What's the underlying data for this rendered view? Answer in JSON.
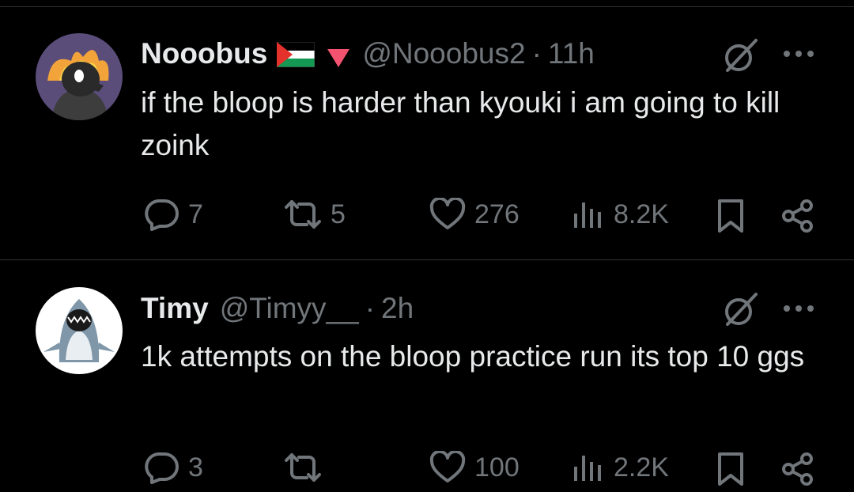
{
  "posts": [
    {
      "author": {
        "name": "Nooobus",
        "handle": "@Nooobus2",
        "time": "11h"
      },
      "text": "if the bloop is harder than kyouki i am going to kill zoink",
      "stats": {
        "replies": "7",
        "reposts": "5",
        "likes": "276",
        "views": "8.2K"
      }
    },
    {
      "author": {
        "name": "Timy",
        "handle": "@Timyy__",
        "time": "2h"
      },
      "text": "1k attempts on the bloop practice run its top 10 ggs",
      "stats": {
        "replies": "3",
        "reposts": "",
        "likes": "100",
        "views": "2.2K"
      }
    }
  ],
  "separator": "·",
  "colors": {
    "background": "#000000",
    "text": "#e7e9ea",
    "muted": "#71767b",
    "divider": "#2f3336",
    "triangle": "#f4536f"
  }
}
